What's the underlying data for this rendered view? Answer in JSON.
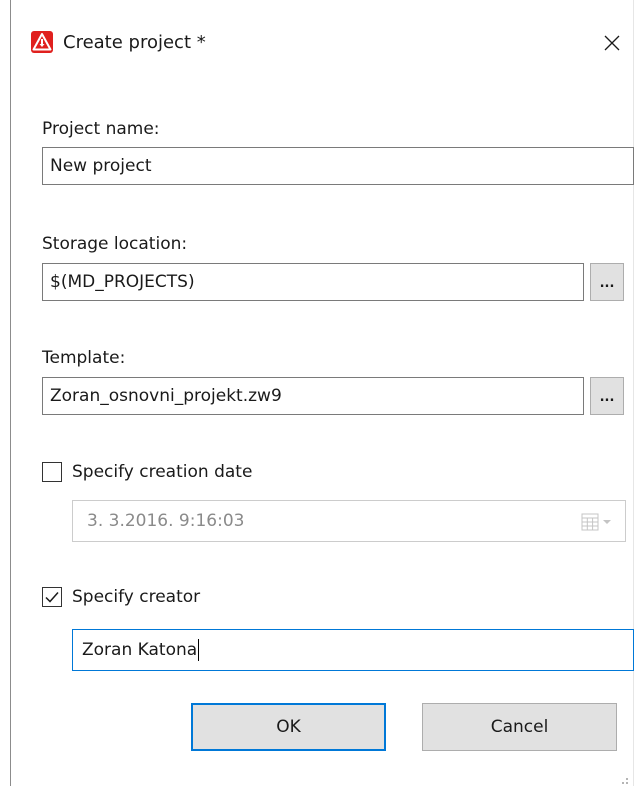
{
  "window": {
    "title": "Create project *",
    "app_icon": "warning-triangle-icon",
    "close_icon": "close-icon",
    "accent_color": "#e0201e"
  },
  "project_name": {
    "label": "Project name:",
    "value": "New project"
  },
  "storage_location": {
    "label": "Storage location:",
    "value": "$(MD_PROJECTS)",
    "browse_label": "..."
  },
  "template": {
    "label": "Template:",
    "value": "Zoran_osnovni_projekt.zw9",
    "browse_label": "..."
  },
  "creation_date": {
    "checkbox_label": "Specify creation date",
    "checked": false,
    "value": "3.  3.2016.   9:16:03",
    "enabled": false,
    "picker_icon": "calendar-dropdown-icon"
  },
  "creator": {
    "checkbox_label": "Specify creator",
    "checked": true,
    "value": "Zoran Katona"
  },
  "buttons": {
    "ok_label": "OK",
    "cancel_label": "Cancel",
    "focus_color": "#0078d7"
  }
}
